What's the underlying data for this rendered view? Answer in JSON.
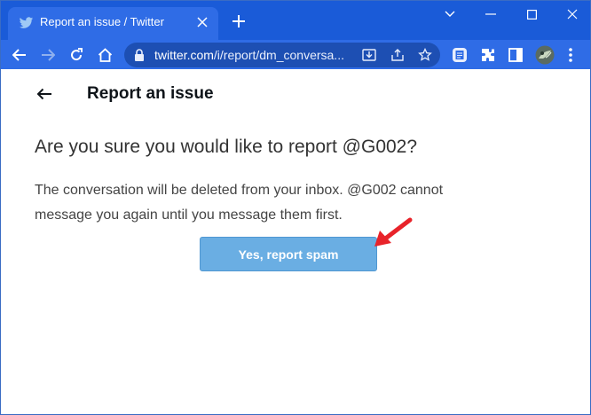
{
  "browser": {
    "tab": {
      "title": "Report an issue / Twitter",
      "icon": "twitter-bird-icon"
    },
    "window_controls": [
      "chevron-down-icon",
      "minimize-icon",
      "maximize-icon",
      "close-icon"
    ],
    "address_bar": {
      "host": "twitter.com",
      "path": "/i/report/dm_conversa..."
    },
    "colors": {
      "frame": "#1a5bd8",
      "toolbar": "#2f6ce6",
      "omnibox": "#1d4fb3"
    }
  },
  "page": {
    "heading": "Report an issue",
    "question": "Are you sure you would like to report @G002?",
    "description": "The conversation will be deleted from your inbox. @G002 cannot message you again until you message them first.",
    "confirm_button": "Yes, report spam",
    "colors": {
      "button": "#6aaee3",
      "annotation_arrow": "#e8232a"
    }
  }
}
